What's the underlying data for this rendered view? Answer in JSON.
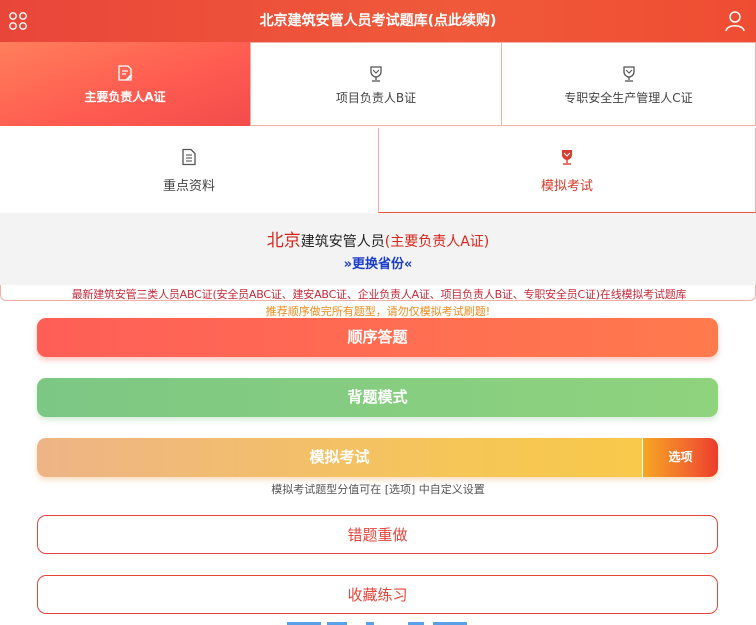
{
  "header": {
    "title": "北京建筑安管人员考试题库(点此续购)",
    "left_icon": "grid-menu-icon",
    "right_icon": "user-icon"
  },
  "tabs_primary": [
    {
      "label": "主要负责人A证",
      "icon": "edit-doc-icon",
      "active": true
    },
    {
      "label": "项目负责人B证",
      "icon": "trophy-icon",
      "active": false
    },
    {
      "label": "专职安全生产管理人C证",
      "icon": "trophy-icon",
      "active": false
    }
  ],
  "tabs_secondary": [
    {
      "label": "重点资料",
      "icon": "document-icon",
      "active": false
    },
    {
      "label": "模拟考试",
      "icon": "trophy-icon",
      "active": true
    }
  ],
  "info": {
    "city": "北京",
    "category": "建筑安管人员",
    "cert": "(主要负责人A证)",
    "change_province": "»更换省份«"
  },
  "notice": "最新建筑安管三类人员ABC证(安全员ABC证、建安ABC证、企业负责人A证、项目负责人B证、专职安全员C证)在线模拟考试题库",
  "tip": "推荐顺序做完所有题型，请勿仅模拟考试刷题!",
  "buttons": {
    "order": "顺序答题",
    "memorize": "背题模式",
    "mock": "模拟考试",
    "options": "选项",
    "mock_note": "模拟考试题型分值可在 [选项] 中自定义设置",
    "wrong": "错题重做",
    "favorites": "收藏练习"
  },
  "colors": {
    "header": "#ee4e38",
    "accent_red": "#e8453a",
    "link_blue": "#1a3ccd",
    "green": "#86cd80",
    "yellow": "#f6c657"
  }
}
